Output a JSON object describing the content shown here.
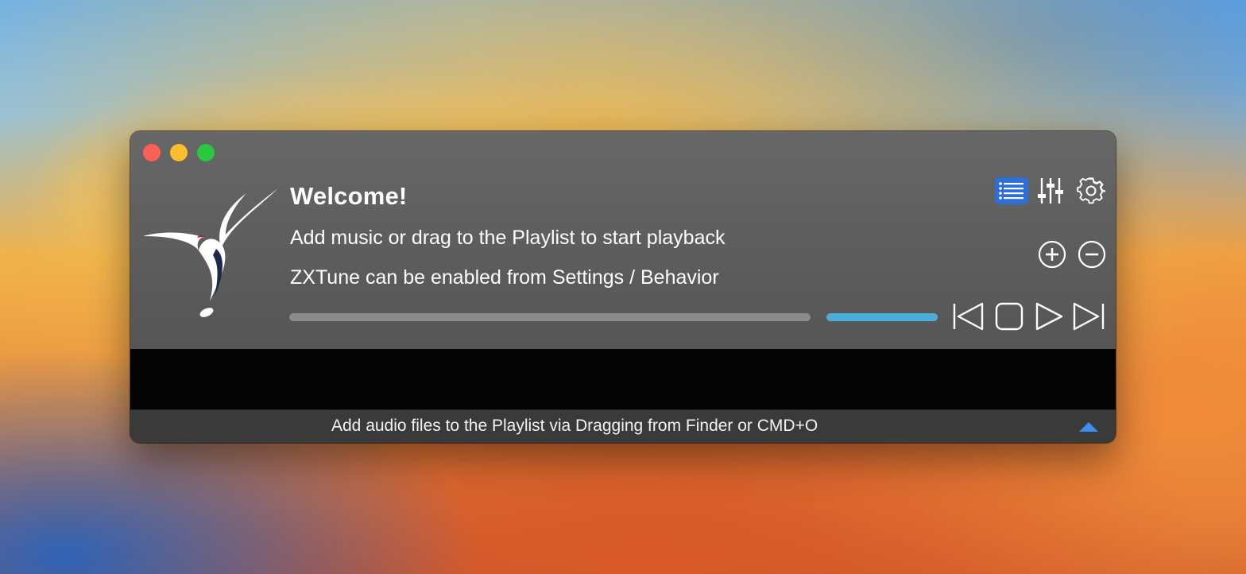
{
  "window": {
    "traffic_lights": [
      "close",
      "minimize",
      "zoom"
    ]
  },
  "header": {
    "welcome": "Welcome!",
    "line1": "Add music or drag to the Playlist to start playback",
    "line2": "ZXTune can be enabled from Settings / Behavior"
  },
  "toolbar": {
    "icons": [
      "playlist-icon",
      "equalizer-icon",
      "gear-icon"
    ],
    "add_icon": "plus-circle-icon",
    "remove_icon": "minus-circle-icon"
  },
  "transport": {
    "progress": 0.0,
    "volume": 1.0,
    "icons": [
      "previous-icon",
      "stop-icon",
      "play-icon",
      "next-icon"
    ]
  },
  "status": {
    "text": "Add audio files to the Playlist via Dragging from Finder or CMD+O"
  },
  "colors": {
    "accent": "#2d6fd6",
    "volume": "#4aaed8",
    "close": "#fe5f57",
    "minimize": "#febc2e",
    "zoom": "#28c840"
  }
}
